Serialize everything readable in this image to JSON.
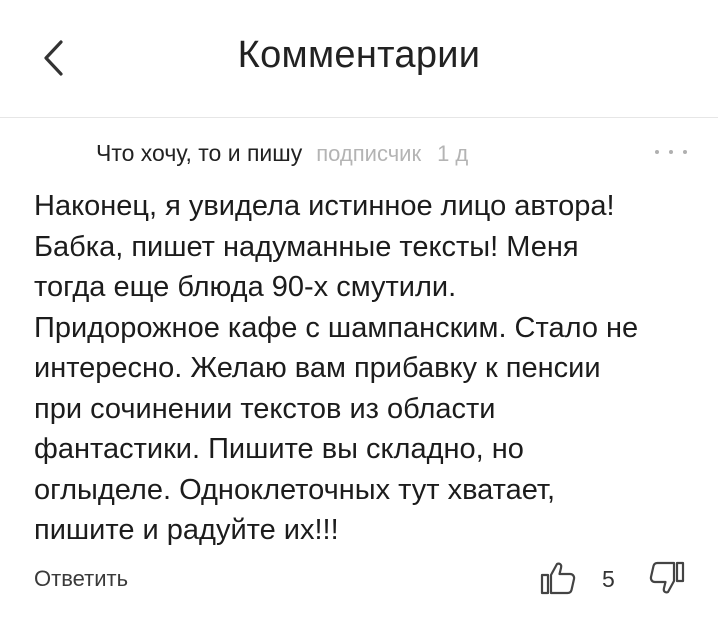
{
  "header": {
    "title": "Комментарии",
    "back_icon": "chevron-left-icon"
  },
  "comment": {
    "author": "Что хочу, то и пишу",
    "role": "подписчик",
    "time": "1 д",
    "more_icon": "more-dots-icon",
    "text": "Наконец, я увидела истинное лицо автора!\nБабка, пишет надуманные тексты! Меня\nтогда еще блюда 90-х смутили.\nПридорожное кафе с шампанским. Стало не\nинтересно. Желаю вам прибавку к пенсии\nпри сочинении текстов из области\nфантастики. Пишите вы складно,  но\nоглыделе.  Одноклеточных тут хватает,\nпишите и радуйте их!!!"
  },
  "actions": {
    "reply_label": "Ответить",
    "like_icon": "thumbs-up-icon",
    "like_count": "5",
    "dislike_icon": "thumbs-down-icon"
  },
  "colors": {
    "text": "#1c1c1c",
    "muted": "#b4b4b4",
    "divider": "#e6e6e6",
    "icon": "#444444"
  }
}
